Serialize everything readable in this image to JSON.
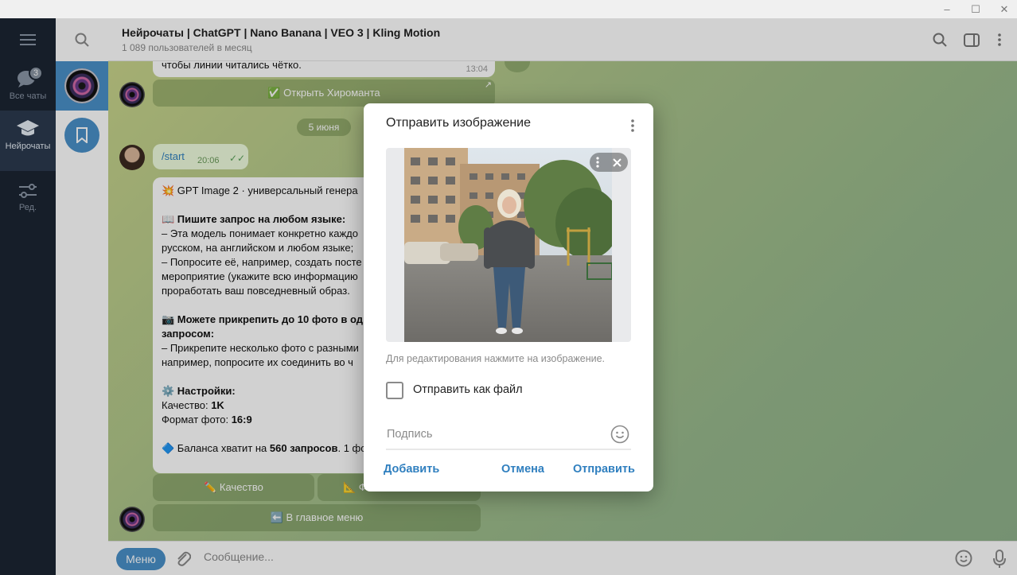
{
  "window": {
    "minimize": "–",
    "maximize": "☐",
    "close": "✕"
  },
  "rail": {
    "items": [
      {
        "label": "Все чаты",
        "badge": "3",
        "icon": "chats-icon"
      },
      {
        "label": "Нейрочаты",
        "icon": "graduation-cap-icon"
      },
      {
        "label": "Ред.",
        "icon": "sliders-icon"
      }
    ]
  },
  "header": {
    "title": "Нейрочаты | ChatGPT | Nano Banana | VEO 3 | Kling Motion",
    "subtitle": "1 089 пользователей в месяц"
  },
  "chat": {
    "top_text": "чтобы линии читались чётко.",
    "top_time": "13:04",
    "open_btn": "✅ Открыть Хироманта",
    "date": "5 июня",
    "start_text": "/start",
    "start_time": "20:06",
    "bot_title": "💥 GPT Image 2 · универсальный генера",
    "sec1_title": "📖 Пишите запрос на любом языке:",
    "sec1_l1": "– Эта модель понимает конкретно каждо",
    "sec1_l2": "русском, на английском и любом языке;",
    "sec1_l3": "– Попросите её, например, создать посте",
    "sec1_l4": "мероприятие (укажите всю информацию",
    "sec1_l5": "проработать ваш повседневный образ.",
    "sec2_title_a": "📷 Можете прикрепить до 10 фото в од",
    "sec2_title_b": "запросом:",
    "sec2_l1": "– Прикрепите несколько фото с разными",
    "sec2_l2": "например, попросите их соединить во ч",
    "sec3_title": "⚙️ Настройки:",
    "quality_label": "Качество: ",
    "quality_value": "1K",
    "format_label": "Формат фото: ",
    "format_value": "16:9",
    "balance_pre": "🔷 Баланса хватит на ",
    "balance_value": "560 запросов",
    "balance_post": ". 1 фо",
    "btn_quality": "✏️ Качество",
    "btn_format": "📐 Ф",
    "btn_main_menu": "⬅️ В главное меню"
  },
  "composer": {
    "menu": "Меню",
    "placeholder": "Сообщение..."
  },
  "dialog": {
    "title": "Отправить изображение",
    "hint": "Для редактирования нажмите на изображение.",
    "send_as_file": "Отправить как файл",
    "caption_placeholder": "Подпись",
    "add": "Добавить",
    "cancel": "Отмена",
    "send": "Отправить"
  },
  "colors": {
    "accent": "#2f7fbf",
    "rail_bg": "#1c2533",
    "chat_bg": "#a9c28a"
  }
}
